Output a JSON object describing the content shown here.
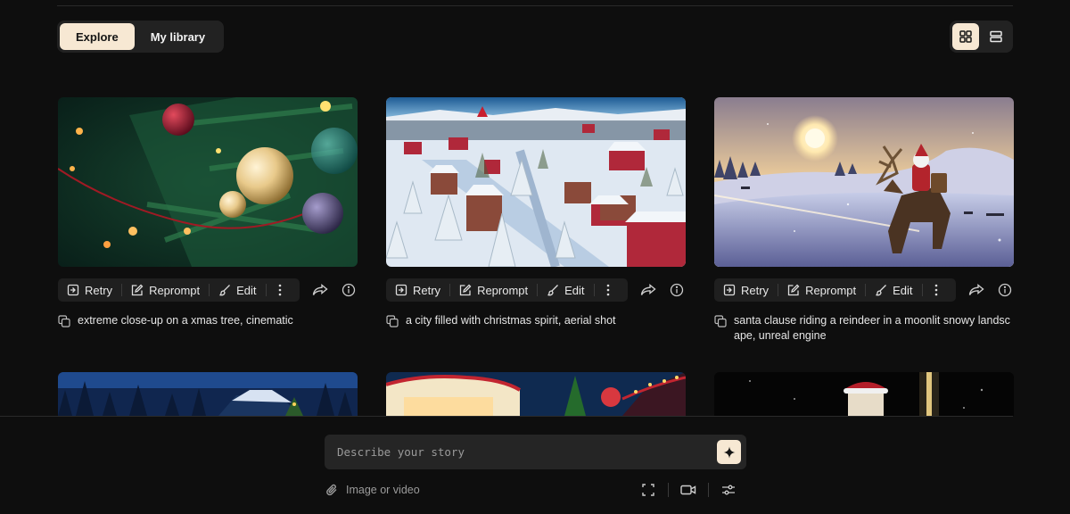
{
  "tabs": [
    {
      "label": "Explore",
      "active": true
    },
    {
      "label": "My library",
      "active": false
    }
  ],
  "view_toggle": {
    "active": "grid",
    "icons": [
      "grid-view-icon",
      "list-view-icon"
    ]
  },
  "action_labels": {
    "retry": "Retry",
    "reprompt": "Reprompt",
    "edit": "Edit"
  },
  "icons": {
    "retry": "retry-icon",
    "reprompt": "reprompt-icon",
    "edit": "brush-icon",
    "more": "more-vertical-icon",
    "share": "share-icon",
    "info": "info-icon",
    "copy": "copy-icon"
  },
  "cards": [
    {
      "caption": "extreme close-up on a xmas tree, cinematic"
    },
    {
      "caption": "a city filled with christmas spirit, aerial shot"
    },
    {
      "caption": "santa clause riding a reindeer in a moonlit snowy landscape, unreal engine"
    }
  ],
  "prompt": {
    "placeholder": "Describe your story",
    "submit_icon": "sparkle-icon"
  },
  "attach": {
    "label": "Image or video",
    "icon": "paperclip-icon"
  },
  "tools": [
    "aspect-ratio-icon",
    "camera-icon",
    "settings-sliders-icon"
  ],
  "colors": {
    "accent": "#f7e8d3",
    "background": "#0e0e0e",
    "surface": "#222222"
  }
}
